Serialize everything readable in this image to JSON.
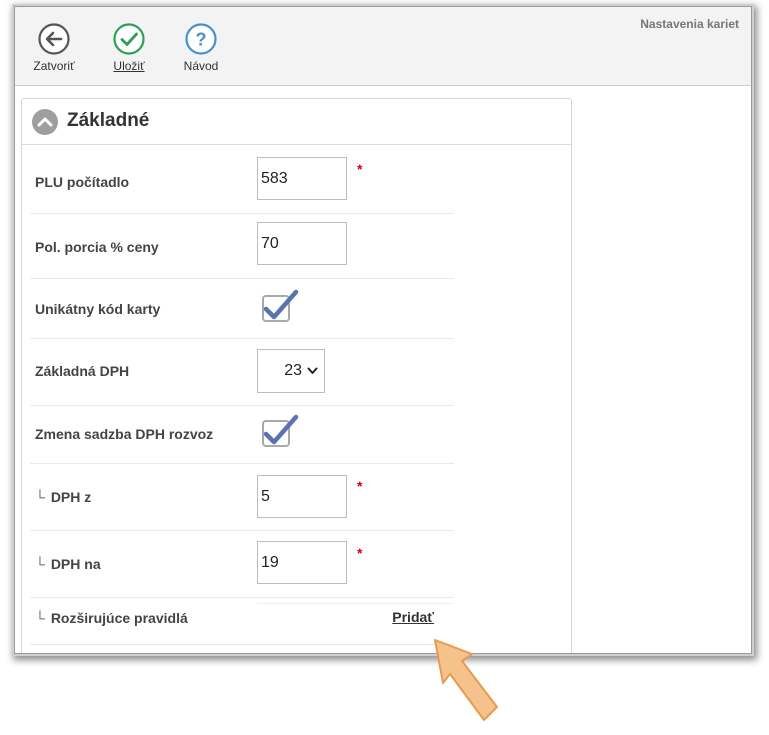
{
  "window": {
    "title": "Nastavenia kariet"
  },
  "toolbar": {
    "close_label": "Zatvoriť",
    "save_label": "Uložiť",
    "help_label": "Návod"
  },
  "section": {
    "title": "Základné",
    "fields": {
      "plu_counter": {
        "label": "PLU počítadlo",
        "value": "583",
        "required": "*"
      },
      "portion_price": {
        "label": "Pol. porcia % ceny",
        "value": "70"
      },
      "unique_code": {
        "label": "Unikátny kód karty",
        "checked": true
      },
      "base_vat": {
        "label": "Základná DPH",
        "value": "23"
      },
      "vat_change_delivery": {
        "label": "Zmena sadzba DPH rozvoz",
        "checked": true
      },
      "vat_from": {
        "prefix": "└",
        "label": "DPH z",
        "value": "5",
        "required": "*"
      },
      "vat_to": {
        "prefix": "└",
        "label": "DPH na",
        "value": "19",
        "required": "*"
      },
      "extended_rules": {
        "prefix": "└",
        "label": "Rozširujúce pravidlá",
        "action": "Pridať"
      }
    }
  },
  "colors": {
    "close_icon": "#555555",
    "save_icon": "#2e9e57",
    "help_icon": "#4a90c8",
    "checkmark": "#5b72b0",
    "required": "#d0021b",
    "arrow_fill": "#f6c28c",
    "arrow_stroke": "#e89a4e"
  }
}
